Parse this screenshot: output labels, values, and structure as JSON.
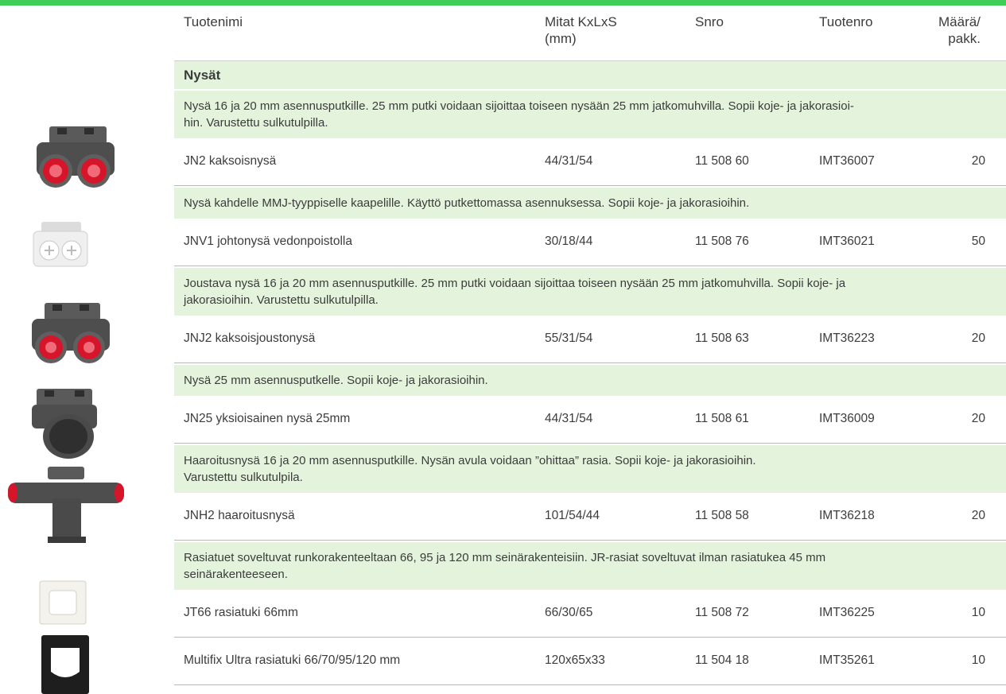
{
  "header": {
    "name": "Tuotenimi",
    "dims": [
      "Mitat KxLxS",
      "(mm)"
    ],
    "snro": "Snro",
    "tuotenro": "Tuotenro",
    "qty": [
      "Määrä/",
      "pakk."
    ]
  },
  "section_title": "Nysät",
  "groups": [
    {
      "desc": [
        "Nysä 16 ja 20 mm asennusputkille. 25 mm putki voidaan sijoittaa toiseen nysään 25 mm jatkomuhvilla. Sopii koje- ja jakorasioi-",
        "hin. Varustettu sulkutulpilla."
      ],
      "rows": [
        {
          "name": "JN2 kaksoisnysä",
          "dims": "44/31/54",
          "snro": "11 508 60",
          "tuotenro": "IMT36007",
          "qty": "20"
        }
      ]
    },
    {
      "desc": [
        "Nysä kahdelle MMJ-tyyppiselle kaapelille. Käyttö putkettomassa asennuksessa. Sopii koje- ja jakorasioihin."
      ],
      "rows": [
        {
          "name": "JNV1 johtonysä vedonpoistolla",
          "dims": "30/18/44",
          "snro": "11 508 76",
          "tuotenro": "IMT36021",
          "qty": "50"
        }
      ]
    },
    {
      "desc": [
        "Joustava nysä 16 ja 20 mm asennusputkille. 25 mm putki voidaan sijoittaa toiseen nysään 25 mm jatkomuhvilla. Sopii koje- ja",
        "jakorasioihin. Varustettu sulkutulpilla."
      ],
      "rows": [
        {
          "name": "JNJ2 kaksoisjoustonysä",
          "dims": "55/31/54",
          "snro": "11 508 63",
          "tuotenro": "IMT36223",
          "qty": "20"
        }
      ]
    },
    {
      "desc": [
        "Nysä 25 mm asennusputkelle. Sopii koje- ja jakorasioihin."
      ],
      "rows": [
        {
          "name": "JN25 yksioisainen nysä 25mm",
          "dims": "44/31/54",
          "snro": "11 508 61",
          "tuotenro": "IMT36009",
          "qty": "20"
        }
      ]
    },
    {
      "desc": [
        "Haaroitusnysä 16 ja 20 mm asennusputkille. Nysän avula voidaan ”ohittaa” rasia. Sopii koje- ja jakorasioihin.",
        "Varustettu sulkutulpila."
      ],
      "rows": [
        {
          "name": "JNH2 haaroitusnysä",
          "dims": "101/54/44",
          "snro": "11 508 58",
          "tuotenro": "IMT36218",
          "qty": "20"
        }
      ]
    },
    {
      "desc": [
        "Rasiatuet soveltuvat runkorakenteeltaan 66, 95 ja 120 mm seinärakenteisiin. JR-rasiat soveltuvat ilman rasiatukea 45 mm",
        "seinärakenteeseen."
      ],
      "rows": [
        {
          "name": "JT66 rasiatuki 66mm",
          "dims": "66/30/65",
          "snro": "11 508 72",
          "tuotenro": "IMT36225",
          "qty": "10"
        },
        {
          "name": "Multifix Ultra rasiatuki 66/70/95/120 mm",
          "dims": "120x65x33",
          "snro": "11 504 18",
          "tuotenro": "IMT35261",
          "qty": "10"
        }
      ]
    }
  ],
  "colors": {
    "accent": "#3dcd58",
    "row_bg": "#e3f3dc",
    "text": "#3c3c3c"
  },
  "images": [
    "jn2-product-image",
    "jnv1-product-image",
    "jnj2-product-image",
    "jn25-product-image",
    "jnh2-product-image",
    "jt66-product-image",
    "multifix-product-image"
  ]
}
